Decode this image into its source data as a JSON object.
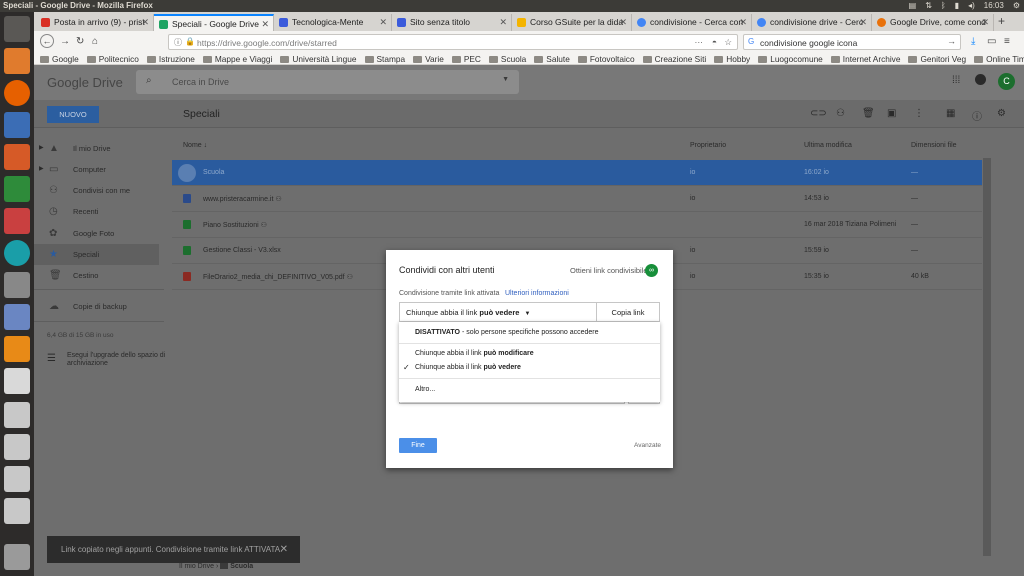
{
  "os": {
    "window_title": "Speciali - Google Drive - Mozilla Firefox",
    "clock": "16:03"
  },
  "tabs": [
    {
      "label": "Posta in arrivo (9) - prist",
      "color": "#d93025",
      "active": false
    },
    {
      "label": "Speciali - Google Drive",
      "color": "#1fa463",
      "active": true
    },
    {
      "label": "Tecnologica-Mente",
      "color": "#3b5bdb",
      "active": false
    },
    {
      "label": "Sito senza titolo",
      "color": "#3b5bdb",
      "active": false
    },
    {
      "label": "Corso GSuite per la dida",
      "color": "#f4b400",
      "active": false
    },
    {
      "label": "condivisione - Cerca con",
      "color": "#4285f4",
      "active": false
    },
    {
      "label": "condivisione drive - Cerc",
      "color": "#4285f4",
      "active": false
    },
    {
      "label": "Google Drive, come cond",
      "color": "#e8710a",
      "active": false
    }
  ],
  "navbar": {
    "url": "https://drive.google.com/drive/starred",
    "search_value": "condivisione google icona",
    "more": "···"
  },
  "bookmarks": [
    "Google",
    "Politecnico",
    "Istruzione",
    "Mappe e Viaggi",
    "Università Lingue",
    "Stampa",
    "Varie",
    "PEC",
    "Scuola",
    "Salute",
    "Fotovoltaico",
    "Creazione Siti",
    "Hobby",
    "Luogocomune",
    "Internet Archive",
    "Genitori Veg",
    "Online Timer"
  ],
  "drive": {
    "logo": "Google Drive",
    "search_placeholder": "Cerca in Drive",
    "avatar_letter": "C",
    "new_button": "NUOVO",
    "section_title": "Speciali",
    "sidebar": [
      "Il mio Drive",
      "Computer",
      "Condivisi con me",
      "Recenti",
      "Google Foto",
      "Speciali",
      "Cestino",
      "Copie di backup"
    ],
    "storage": "6,4 GB di 15 GB in uso",
    "upgrade": "Esegui l'upgrade dello spazio di archiviazione",
    "columns": {
      "name": "Nome",
      "owner": "Proprietario",
      "modified": "Ultima modifica",
      "size": "Dimensioni file"
    },
    "rows": [
      {
        "name": "Scuola",
        "owner": "io",
        "modified": "16:02 io",
        "size": "—",
        "icon_color": "#8ea9cc"
      },
      {
        "name": "www.pristeracarmine.it",
        "owner": "io",
        "modified": "14:53 io",
        "size": "—",
        "icon_color": "#2a4a8a"
      },
      {
        "name": "Piano Sostituzioni",
        "owner": "",
        "modified": "16 mar 2018 Tiziana Polimeni",
        "size": "—",
        "icon_color": "#1c6e2e"
      },
      {
        "name": "Gestione Classi - V3.xlsx",
        "owner": "io",
        "modified": "15:59 io",
        "size": "—",
        "icon_color": "#1c6e2e"
      },
      {
        "name": "FileOrario2_media_chi_DEFINITIVO_V05.pdf",
        "owner": "io",
        "modified": "15:35 io",
        "size": "40 kB",
        "icon_color": "#8b2a22"
      }
    ],
    "breadcrumb_root": "Il mio Drive",
    "breadcrumb_sep": "›",
    "breadcrumb_current": "Scuola",
    "toast": "Link copiato negli appunti. Condivisione tramite link ATTIVATA."
  },
  "dialog": {
    "title": "Condividi con altri utenti",
    "get_link": "Ottieni link condivisibile",
    "link_status": "Condivisione tramite link attivata",
    "more_info": "Ulteriori informazioni",
    "perm_prefix": "Chiunque abbia il link",
    "perm_value": "può vedere",
    "copy_link": "Copia link",
    "menu": {
      "off_bold": "DISATTIVATO",
      "off_rest": "- solo persone specifiche possono accedere",
      "edit_prefix": "Chiunque abbia il link",
      "edit_bold": "può modificare",
      "view_prefix": "Chiunque abbia il link",
      "view_bold": "può vedere",
      "other": "Altro..."
    },
    "done": "Fine",
    "advanced": "Avanzate"
  }
}
